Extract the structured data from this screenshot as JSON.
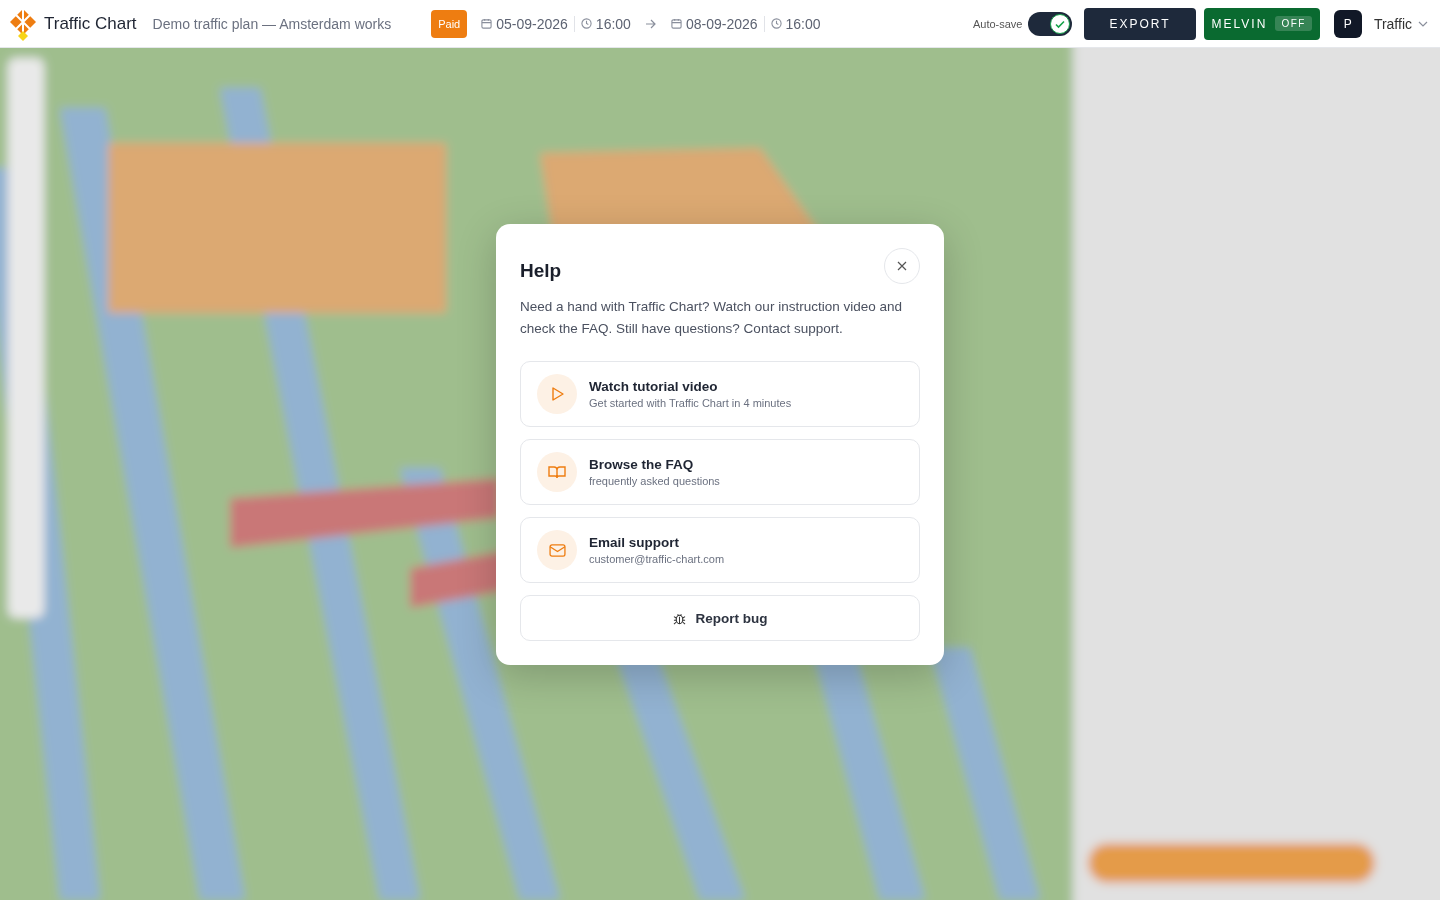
{
  "header": {
    "app_name": "Traffic Chart",
    "plan_title": "Demo traffic plan — Amsterdam works",
    "plan_status": "Paid",
    "start_date": "05-09-2026",
    "start_time": "16:00",
    "end_date": "08-09-2026",
    "end_time": "16:00",
    "autosave_label": "Auto-save",
    "autosave": {
      "on": true
    },
    "export_label": "EXPORT",
    "assistant": {
      "label": "MELVIN",
      "state_label": "OFF"
    },
    "account": {
      "avatar": "P",
      "name": "Traffic"
    }
  },
  "dialog": {
    "title": "Help",
    "intro": "Need a hand with Traffic Chart? Watch our instruction video and check the FAQ. Still have questions? Contact support.",
    "options": [
      {
        "kind": "video",
        "title": "Watch tutorial video",
        "subtitle": "Get started with Traffic Chart in 4 minutes"
      },
      {
        "kind": "faq",
        "title": "Browse the FAQ",
        "subtitle": "frequently asked questions"
      },
      {
        "kind": "email",
        "title": "Email support",
        "subtitle": "customer@traffic-chart.com"
      }
    ],
    "report_label": "Report bug"
  }
}
